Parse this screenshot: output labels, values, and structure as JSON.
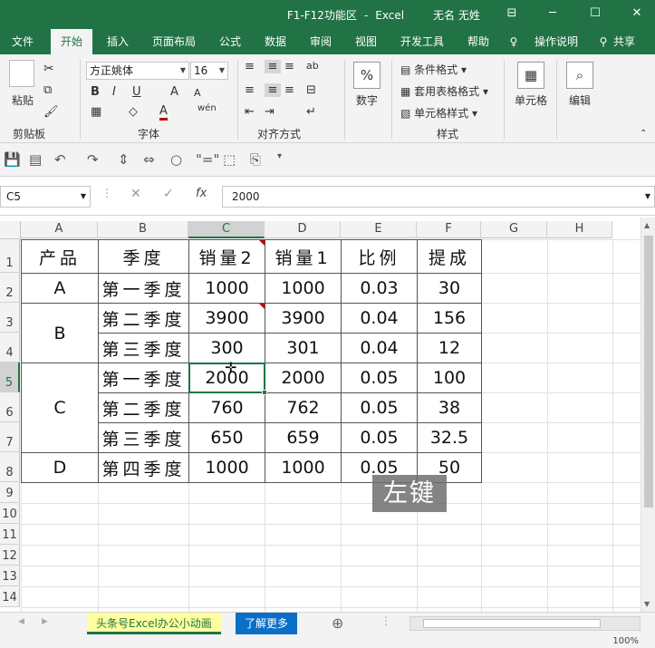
{
  "window": {
    "title": "F1-F12功能区",
    "app": "Excel",
    "separator": "-",
    "user": "无名 无姓",
    "minimize_glyph": "─",
    "maximize_glyph": "☐",
    "close_glyph": "✕",
    "ribbon_display_glyph": "⊟"
  },
  "ribbon_tabs": [
    "文件",
    "开始",
    "插入",
    "页面布局",
    "公式",
    "数据",
    "审阅",
    "视图",
    "开发工具",
    "帮助"
  ],
  "ribbon_extra": {
    "tell_me": "操作说明",
    "share": "共享"
  },
  "ribbon": {
    "clipboard": {
      "paste": "粘贴",
      "group_label": "剪贴板"
    },
    "font": {
      "font_name": "方正姚体",
      "font_size": "16",
      "bold": "B",
      "italic": "I",
      "underline": "U",
      "grow": "A",
      "shrink": "A",
      "font_color": "A",
      "phonetic": "wén",
      "group_label": "字体"
    },
    "alignment": {
      "group_label": "对齐方式"
    },
    "number": {
      "label": "数字",
      "icon": "%"
    },
    "styles": {
      "conditional": "条件格式",
      "table": "套用表格格式",
      "cell_styles": "单元格样式",
      "group_label": "样式"
    },
    "cells": {
      "label": "单元格"
    },
    "editing": {
      "label": "编辑"
    }
  },
  "formula_bar": {
    "name_box": "C5",
    "value": "2000",
    "cancel": "✕",
    "enter": "✓",
    "fx": "fx"
  },
  "columns": [
    "A",
    "B",
    "C",
    "D",
    "E",
    "F",
    "G",
    "H"
  ],
  "rows": [
    "1",
    "2",
    "3",
    "4",
    "5",
    "6",
    "7",
    "8",
    "9",
    "10",
    "11",
    "12",
    "13",
    "14"
  ],
  "table": {
    "headers": [
      "产品",
      "季度",
      "销量2",
      "销量1",
      "比例",
      "提成"
    ],
    "products": [
      "A",
      "B",
      "C",
      "D"
    ],
    "seasons": [
      "第一季度",
      "第二季度",
      "第三季度",
      "第一季度",
      "第二季度",
      "第三季度",
      "第四季度"
    ],
    "sales2": [
      "1000",
      "3900",
      "300",
      "2000",
      "760",
      "650",
      "1000"
    ],
    "sales1": [
      "1000",
      "3900",
      "301",
      "2000",
      "762",
      "659",
      "1000"
    ],
    "ratio": [
      "0.03",
      "0.04",
      "0.04",
      "0.05",
      "0.05",
      "0.05",
      "0.05"
    ],
    "commission": [
      "30",
      "156",
      "12",
      "100",
      "38",
      "32.5",
      "50"
    ]
  },
  "overlay_text": "左键",
  "sheet_tabs": {
    "sheet1": "头条号Excel办公小动画",
    "more": "了解更多",
    "add": "⊕"
  },
  "status": {
    "zoom": "100%"
  }
}
